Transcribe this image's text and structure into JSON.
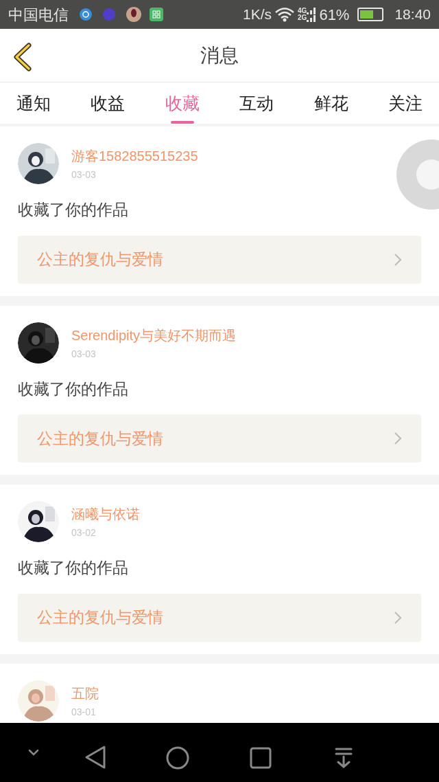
{
  "status_bar": {
    "carrier": "中国电信",
    "speed": "1K/s",
    "network_top": "4G",
    "network_bottom": "2G",
    "battery": "61%",
    "time": "18:40"
  },
  "header": {
    "title": "消息"
  },
  "tabs": [
    {
      "label": "通知",
      "selected": false
    },
    {
      "label": "收益",
      "selected": false
    },
    {
      "label": "收藏",
      "selected": true
    },
    {
      "label": "互动",
      "selected": false
    },
    {
      "label": "鲜花",
      "selected": false
    },
    {
      "label": "关注",
      "selected": false
    }
  ],
  "messages": [
    {
      "user": "游客1582855515235",
      "date": "03-03",
      "action": "收藏了你的作品",
      "work": "公主的复仇与爱情"
    },
    {
      "user": "Serendipity与美好不期而遇",
      "date": "03-03",
      "action": "收藏了你的作品",
      "work": "公主的复仇与爱情"
    },
    {
      "user": "涵曦与依诺",
      "date": "03-02",
      "action": "收藏了你的作品",
      "work": "公主的复仇与爱情"
    },
    {
      "user": "五院",
      "date": "03-01"
    }
  ]
}
